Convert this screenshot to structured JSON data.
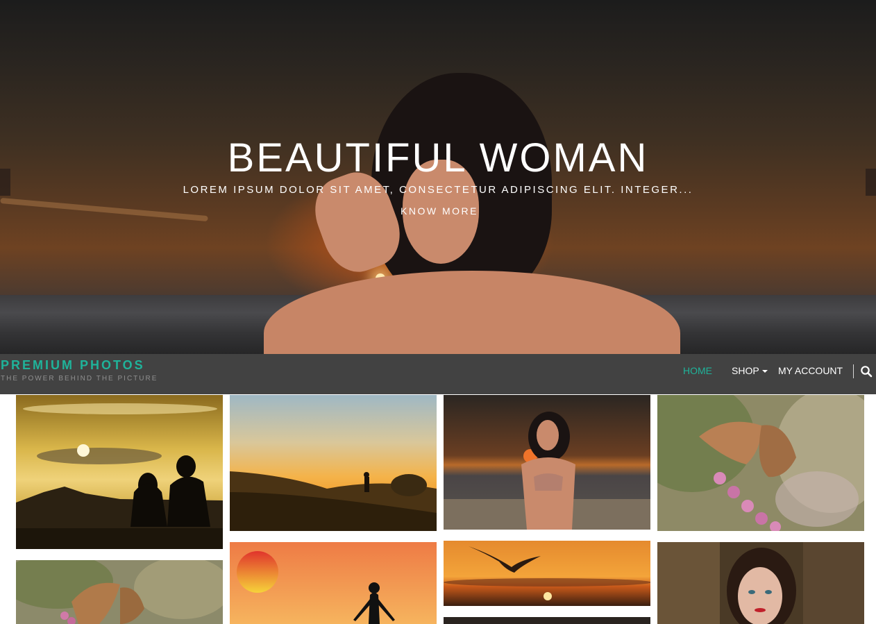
{
  "hero": {
    "title": "BEAUTIFUL WOMAN",
    "subtitle": "LOREM IPSUM DOLOR SIT AMET, CONSECTETUR ADIPISCING ELIT. INTEGER...",
    "button_label": "KNOW MORE"
  },
  "brand": {
    "title": "PREMIUM PHOTOS",
    "tagline": "THE POWER BEHIND THE PICTURE"
  },
  "nav": {
    "items": [
      {
        "label": "HOME",
        "active": true
      },
      {
        "label": "SHOP",
        "has_dropdown": true
      },
      {
        "label": "MY ACCOUNT"
      }
    ],
    "search_icon": "search-icon"
  },
  "colors": {
    "accent": "#1fb39a",
    "navbar": "#424242",
    "tagline": "#8f8f8f"
  },
  "gallery": {
    "photos": [
      {
        "subject": "couple-silhouette-sunset"
      },
      {
        "subject": "person-on-hill-sunset"
      },
      {
        "subject": "woman-on-beach"
      },
      {
        "subject": "butterfly-on-flowers"
      },
      {
        "subject": "butterfly-on-flowers"
      },
      {
        "subject": "woman-silhouette-orange-sky"
      },
      {
        "subject": "seagull-sunset"
      },
      {
        "subject": "woman-portrait-forest"
      },
      {
        "subject": "dark-photo"
      }
    ]
  }
}
